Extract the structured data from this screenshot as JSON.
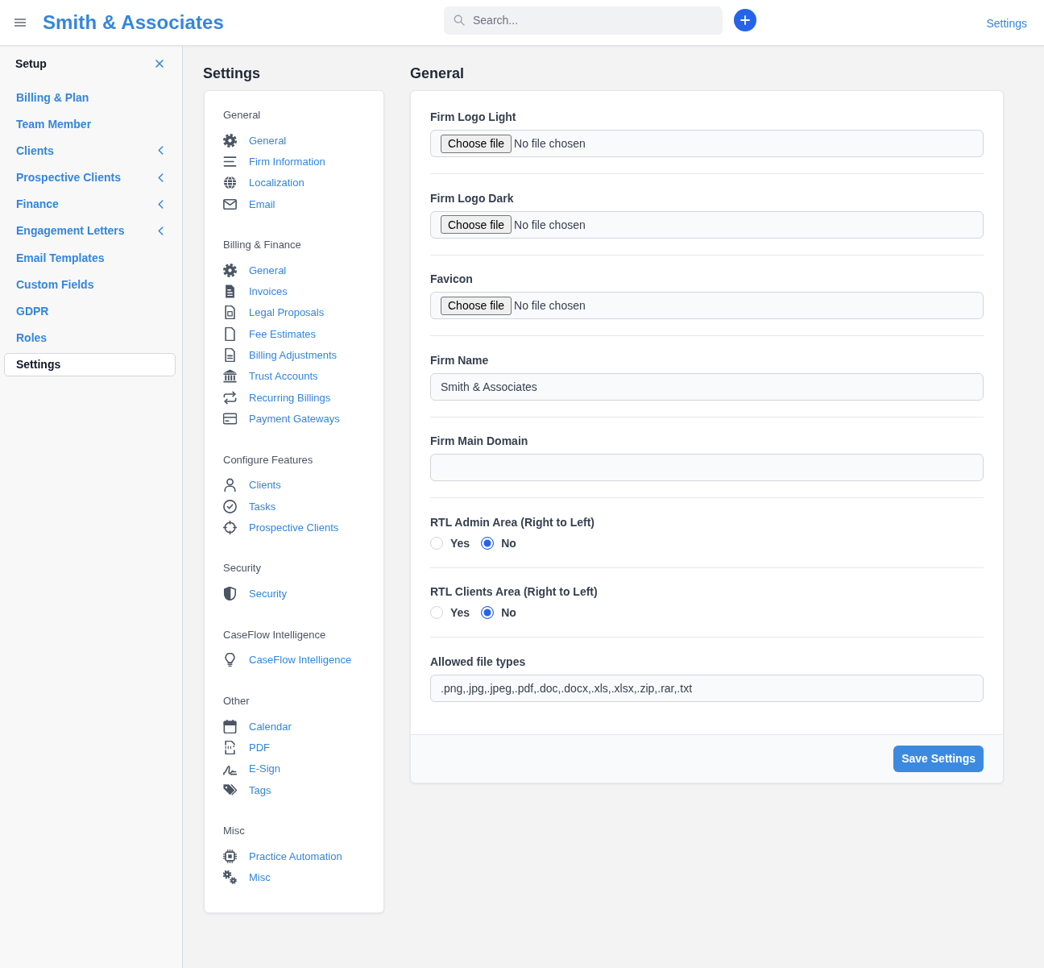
{
  "topbar": {
    "brand": "Smith & Associates",
    "search": {
      "placeholder": "Search..."
    },
    "link": "Settings"
  },
  "sidebar": {
    "title": "Setup",
    "items": [
      {
        "label": "Billing & Plan",
        "kind": "link",
        "selected": false
      },
      {
        "label": "Team Member",
        "kind": "link",
        "selected": false
      },
      {
        "label": "Clients",
        "kind": "group",
        "selected": false
      },
      {
        "label": "Prospective Clients",
        "kind": "group",
        "selected": false
      },
      {
        "label": "Finance",
        "kind": "group",
        "selected": false
      },
      {
        "label": "Engagement Letters",
        "kind": "group",
        "selected": false
      },
      {
        "label": "Email Templates",
        "kind": "link",
        "selected": false
      },
      {
        "label": "Custom Fields",
        "kind": "link",
        "selected": false
      },
      {
        "label": "GDPR",
        "kind": "link",
        "selected": false
      },
      {
        "label": "Roles",
        "kind": "link",
        "selected": false
      },
      {
        "label": "Settings",
        "kind": "link",
        "selected": true
      }
    ]
  },
  "settings_nav": {
    "title": "Settings",
    "groups": [
      {
        "heading": "General",
        "items": [
          {
            "label": "General"
          },
          {
            "label": "Firm Information"
          },
          {
            "label": "Localization"
          },
          {
            "label": "Email"
          }
        ]
      },
      {
        "heading": "Billing & Finance",
        "items": [
          {
            "label": "General"
          },
          {
            "label": "Invoices"
          },
          {
            "label": "Legal Proposals"
          },
          {
            "label": "Fee Estimates"
          },
          {
            "label": "Billing Adjustments"
          },
          {
            "label": "Trust Accounts"
          },
          {
            "label": "Recurring Billings"
          },
          {
            "label": "Payment Gateways"
          }
        ]
      },
      {
        "heading": "Configure Features",
        "items": [
          {
            "label": "Clients"
          },
          {
            "label": "Tasks"
          },
          {
            "label": "Prospective Clients"
          }
        ]
      },
      {
        "heading": "Security",
        "items": [
          {
            "label": "Security"
          }
        ]
      },
      {
        "heading": "CaseFlow Intelligence",
        "items": [
          {
            "label": "CaseFlow Intelligence"
          }
        ]
      },
      {
        "heading": "Other",
        "items": [
          {
            "label": "Calendar"
          },
          {
            "label": "PDF"
          },
          {
            "label": "E-Sign"
          },
          {
            "label": "Tags"
          }
        ]
      },
      {
        "heading": "Misc",
        "items": [
          {
            "label": "Practice Automation"
          },
          {
            "label": "Misc"
          }
        ]
      }
    ]
  },
  "general": {
    "title": "General",
    "fields": [
      {
        "kind": "file",
        "label": "Firm Logo Light",
        "button": "Choose file",
        "status": "No file chosen"
      },
      {
        "kind": "file",
        "label": "Firm Logo Dark",
        "button": "Choose file",
        "status": "No file chosen"
      },
      {
        "kind": "file",
        "label": "Favicon",
        "button": "Choose file",
        "status": "No file chosen"
      },
      {
        "kind": "text",
        "label": "Firm Name",
        "value": "Smith & Associates"
      },
      {
        "kind": "text",
        "label": "Firm Main Domain"
      },
      {
        "kind": "radio",
        "label": "RTL Admin Area (Right to Left)",
        "options": [
          {
            "label": "Yes",
            "selected": false
          },
          {
            "label": "No",
            "selected": true
          }
        ]
      },
      {
        "kind": "radio",
        "label": "RTL Clients Area (Right to Left)",
        "options": [
          {
            "label": "Yes",
            "selected": false
          },
          {
            "label": "No",
            "selected": true
          }
        ]
      },
      {
        "kind": "text",
        "label": "Allowed file types",
        "value": ".png,.jpg,.jpeg,.pdf,.doc,.docx,.xls,.xlsx,.zip,.rar,.txt"
      }
    ],
    "save_button": "Save Settings"
  }
}
